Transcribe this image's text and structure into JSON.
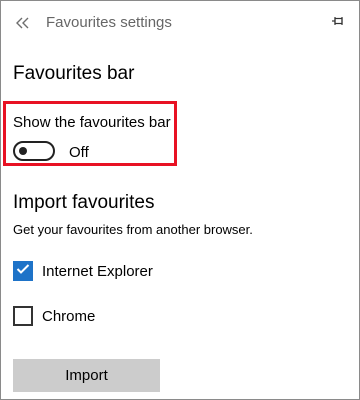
{
  "header": {
    "back_icon": "double-chevron-left-icon",
    "title": "Favourites settings",
    "pin_icon": "pin-icon"
  },
  "favourites_bar": {
    "title": "Favourites bar",
    "toggle_label": "Show the favourites bar",
    "toggle_state": "Off",
    "toggle_on": false,
    "highlight_color": "#e81123"
  },
  "import": {
    "title": "Import favourites",
    "description": "Get your favourites from another browser.",
    "browsers": [
      {
        "label": "Internet Explorer",
        "checked": true
      },
      {
        "label": "Chrome",
        "checked": false
      }
    ],
    "button_label": "Import",
    "checked_color": "#1e73c8"
  }
}
